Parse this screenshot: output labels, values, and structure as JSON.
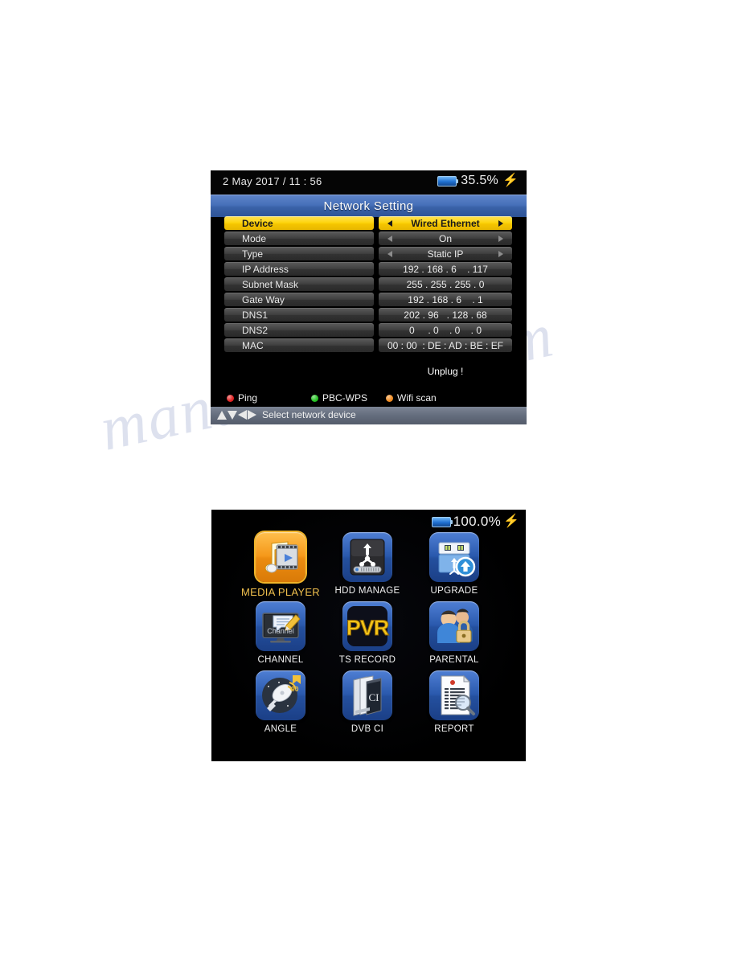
{
  "network_screen": {
    "status": {
      "datetime": "2 May 2017 / 11 : 56",
      "battery_percent": "35.5%",
      "battery_icon": "battery-icon",
      "charging_icon": "lightning-bolt-icon"
    },
    "title": "Network Setting",
    "rows": [
      {
        "label": "Device",
        "value": "Wired Ethernet",
        "selected": true,
        "spinner": true
      },
      {
        "label": "Mode",
        "value": "On",
        "selected": false,
        "spinner": true
      },
      {
        "label": "Type",
        "value": "Static IP",
        "selected": false,
        "spinner": true
      },
      {
        "label": "IP Address",
        "value": "192 . 168 . 6    . 117",
        "selected": false,
        "spinner": false
      },
      {
        "label": "Subnet Mask",
        "value": "255 . 255 . 255 . 0",
        "selected": false,
        "spinner": false
      },
      {
        "label": "Gate Way",
        "value": "192 . 168 . 6    . 1",
        "selected": false,
        "spinner": false
      },
      {
        "label": "DNS1",
        "value": "202 . 96   . 128 . 68",
        "selected": false,
        "spinner": false
      },
      {
        "label": "DNS2",
        "value": "0     . 0    . 0    . 0",
        "selected": false,
        "spinner": false
      },
      {
        "label": "MAC",
        "value": "00 : 00  : DE : AD : BE : EF",
        "selected": false,
        "spinner": false
      }
    ],
    "connection_status": "Unplug !",
    "legend": [
      {
        "label": "Ping",
        "color": "#e02020"
      },
      {
        "label": "PBC-WPS",
        "color": "#22c020"
      },
      {
        "label": "Wifi scan",
        "color": "#f08a1e"
      }
    ],
    "hint": {
      "keys_icon": "dpad-arrows-icon",
      "text": "Select network device"
    }
  },
  "menu_screen": {
    "status": {
      "battery_percent": "100.0%",
      "battery_icon": "battery-icon",
      "charging_icon": "lightning-bolt-icon"
    },
    "tiles": [
      {
        "label": "MEDIA PLAYER",
        "icon": "media-player-icon",
        "selected": true
      },
      {
        "label": "HDD MANAGE",
        "icon": "hdd-manage-icon",
        "selected": false
      },
      {
        "label": "UPGRADE",
        "icon": "upgrade-usb-icon",
        "selected": false
      },
      {
        "label": "CHANNEL",
        "icon": "channel-edit-icon",
        "selected": false
      },
      {
        "label": "TS RECORD",
        "icon": "pvr-icon",
        "selected": false
      },
      {
        "label": "PARENTAL",
        "icon": "parental-lock-icon",
        "selected": false
      },
      {
        "label": "ANGLE",
        "icon": "satellite-angle-icon",
        "selected": false
      },
      {
        "label": "DVB CI",
        "icon": "dvb-ci-icon",
        "selected": false
      },
      {
        "label": "REPORT",
        "icon": "report-icon",
        "selected": false
      }
    ]
  },
  "watermark": {
    "line1": "manualshive.com",
    "line2": "manualshive"
  },
  "colors": {
    "highlight": "#fdd40d",
    "title_blue": "#3a62a8",
    "tile_blue": "#2a59ad",
    "tile_gold": "#f5981a"
  }
}
